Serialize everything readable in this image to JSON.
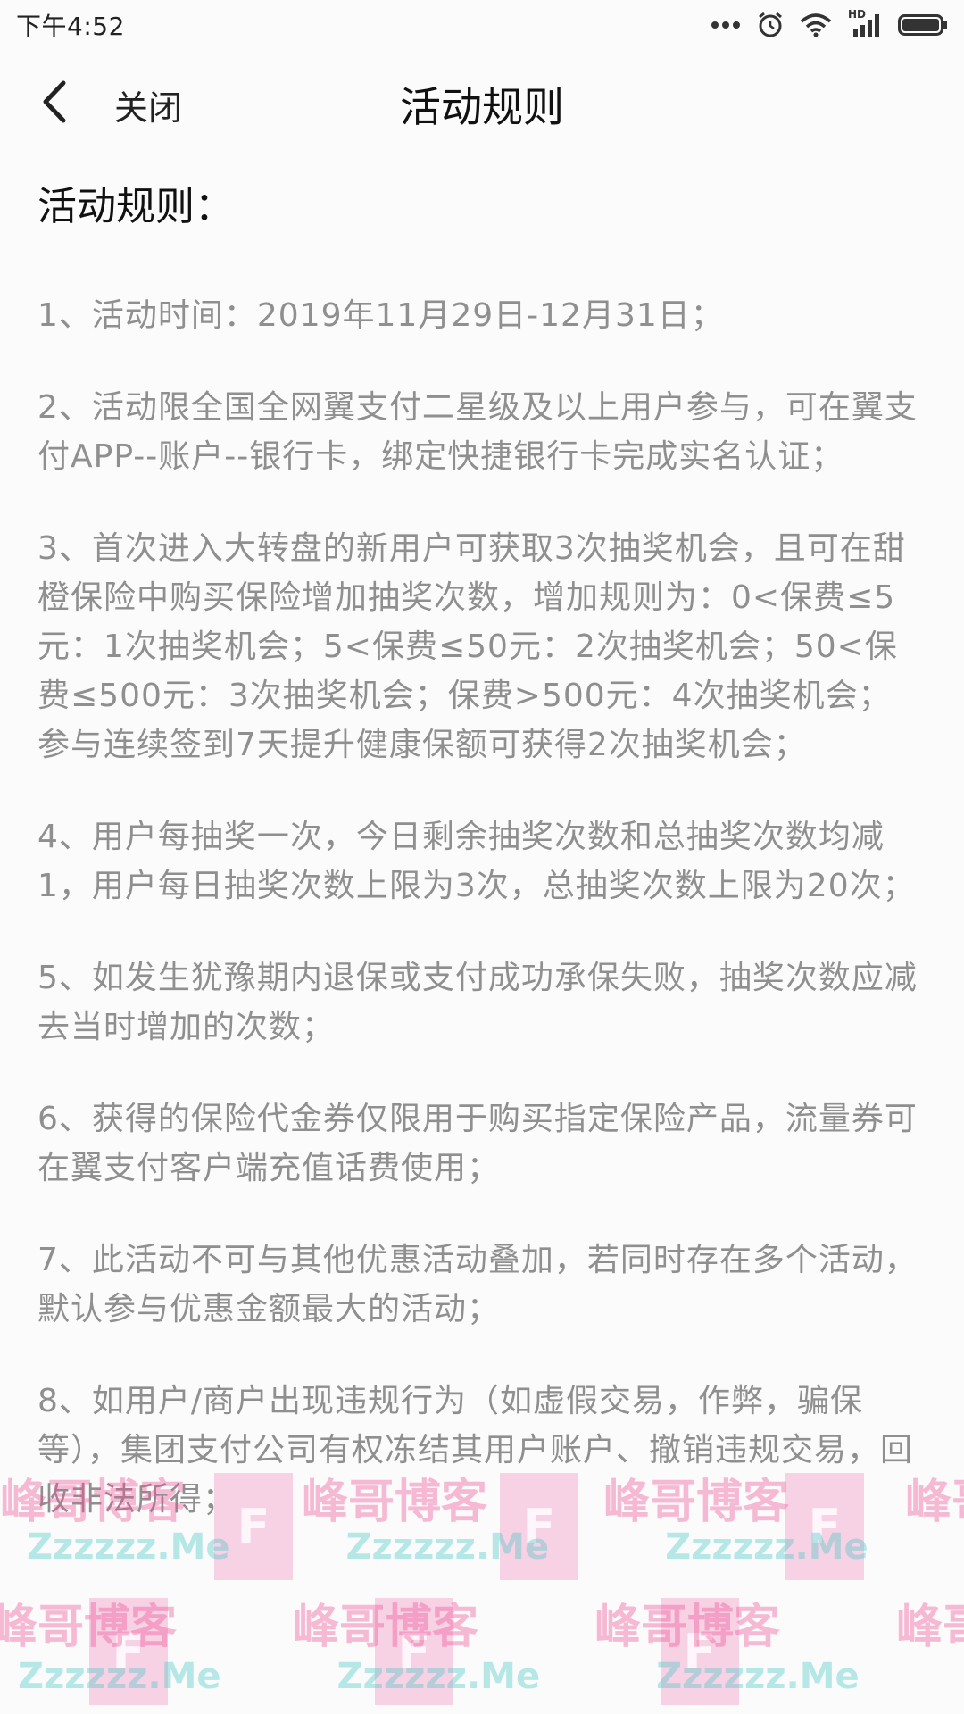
{
  "status_bar": {
    "time": "下午4:52",
    "icons": [
      "more-dots-icon",
      "alarm-icon",
      "wifi-icon",
      "hd-signal-icon",
      "battery-icon"
    ],
    "hd_label": "HD"
  },
  "nav": {
    "back_icon": "chevron-left-icon",
    "close_label": "关闭",
    "title": "活动规则"
  },
  "content": {
    "heading": "活动规则：",
    "rules": [
      "1、活动时间：2019年11月29日-12月31日；",
      "2、活动限全国全网翼支付二星级及以上用户参与，可在翼支付APP--账户--银行卡，绑定快捷银行卡完成实名认证；",
      "3、首次进入大转盘的新用户可获取3次抽奖机会，且可在甜橙保险中购买保险增加抽奖次数，增加规则为：0<保费≤5元：1次抽奖机会；5<保费≤50元：2次抽奖机会；50<保费≤500元：3次抽奖机会；保费>500元：4次抽奖机会；参与连续签到7天提升健康保额可获得2次抽奖机会；",
      "4、用户每抽奖一次，今日剩余抽奖次数和总抽奖次数均减1，用户每日抽奖次数上限为3次，总抽奖次数上限为20次；",
      "5、如发生犹豫期内退保或支付成功承保失败，抽奖次数应减去当时增加的次数；",
      "6、获得的保险代金券仅限用于购买指定保险产品，流量券可在翼支付客户端充值话费使用；",
      "7、此活动不可与其他优惠活动叠加，若同时存在多个活动，默认参与优惠金额最大的活动；",
      "8、如用户/商户出现违规行为（如虚假交易，作弊，骗保等），集团支付公司有权冻结其用户账户、撤销违规交易，回收非法所得；"
    ]
  },
  "watermark": {
    "text": "峰哥博客",
    "sub": "Zzzzzz.Me",
    "badge": "F"
  },
  "colors": {
    "heading": "#111111",
    "rule_text": "#8f8f8f",
    "background": "#fbfbfb"
  }
}
